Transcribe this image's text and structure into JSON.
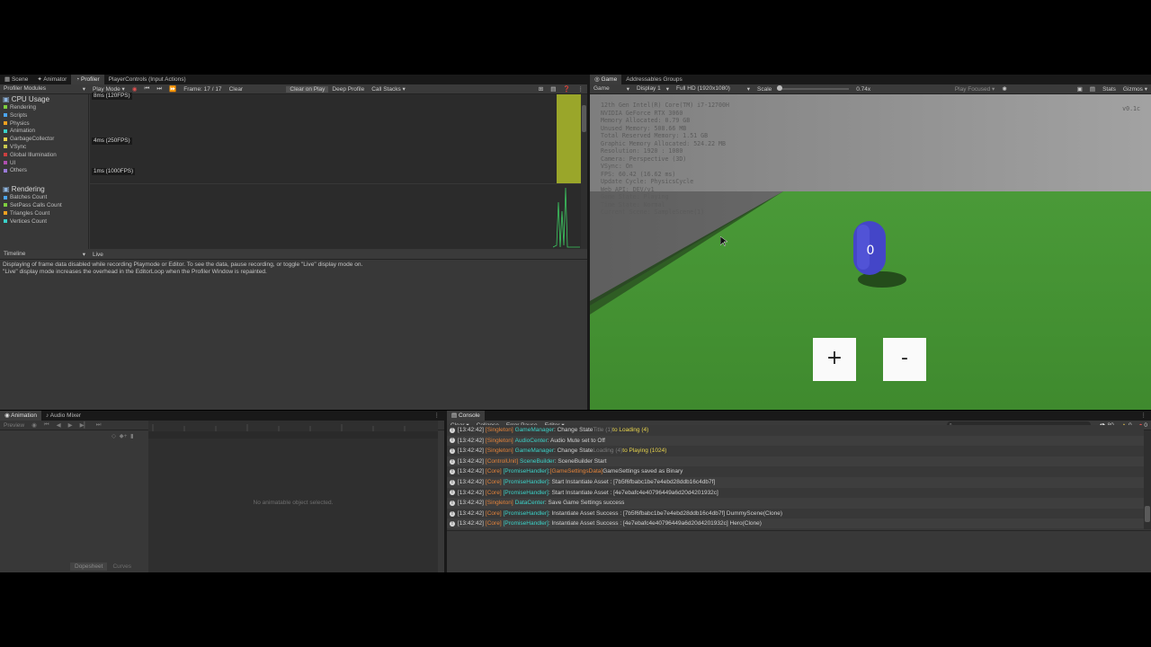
{
  "profiler": {
    "tabs": [
      "Scene",
      "Animator",
      "Profiler",
      "PlayerControls (Input Actions)"
    ],
    "toolbar": {
      "modules_dropdown": "Profiler Modules",
      "mode": "Play Mode",
      "frame": "Frame: 17 / 17",
      "clear": "Clear",
      "clear_on_play": "Clear on Play",
      "deep_profile": "Deep Profile",
      "call_stacks": "Call Stacks"
    },
    "cpu_module": {
      "title": "CPU Usage",
      "items": [
        {
          "label": "Rendering",
          "color": "#7dcf3f"
        },
        {
          "label": "Scripts",
          "color": "#4ba5f2"
        },
        {
          "label": "Physics",
          "color": "#f0a020"
        },
        {
          "label": "Animation",
          "color": "#3ad0c8"
        },
        {
          "label": "GarbageCollector",
          "color": "#e8d44d"
        },
        {
          "label": "VSync",
          "color": "#c8c850"
        },
        {
          "label": "Global Illumination",
          "color": "#cc3f3f"
        },
        {
          "label": "UI",
          "color": "#b04fb0"
        },
        {
          "label": "Others",
          "color": "#9a7ad8"
        }
      ],
      "chart_labels": [
        "8ms (120FPS)",
        "4ms (250FPS)",
        "1ms (1000FPS)"
      ]
    },
    "rendering_module": {
      "title": "Rendering",
      "items": [
        {
          "label": "Batches Count",
          "color": "#4ba5f2"
        },
        {
          "label": "SetPass Calls Count",
          "color": "#7dcf3f"
        },
        {
          "label": "Triangles Count",
          "color": "#f0a020"
        },
        {
          "label": "Vertices Count",
          "color": "#3ad0c8"
        }
      ]
    },
    "details": {
      "view": "Timeline",
      "live": "Live",
      "message_line1": "Displaying of frame data disabled while recording Playmode or Editor. To see the data, pause recording, or toggle \"Live\" display mode on.",
      "message_line2": "\"Live\" display mode increases the overhead in the EditorLoop when the Profiler Window is repainted."
    }
  },
  "game": {
    "tabs": [
      "Game",
      "Addressables Groups"
    ],
    "toolbar": {
      "mode": "Game",
      "display": "Display 1",
      "resolution": "Full HD (1920x1080)",
      "scale_label": "Scale",
      "scale_value": "0.74x",
      "play_focused": "Play Focused",
      "stats": "Stats",
      "gizmos": "Gizmos"
    },
    "hud_lines": [
      "12th Gen Intel(R) Core(TM) i7-12700H",
      "NVIDIA GeForce RTX 3060",
      "Memory Allocated: 0.79 GB",
      "Unused Memory: 508.66 MB",
      "Total Reserved Memory: 1.51 GB",
      "Graphic Memory Allocated: 524.22 MB",
      "Resolution: 1920 : 1080",
      "Camera: Perspective (3D)",
      "VSync: On",
      "FPS: 60.42 (16.62 ms)",
      "Update Cycle: PhysicsCycle",
      "Web API: DEV/v1",
      "Game State: Playing",
      "Time State: Normal",
      "Current Scene: SampleScene(1)"
    ],
    "version": "v0.1c",
    "counter": "0",
    "plus_label": "+",
    "minus_label": "-"
  },
  "animation": {
    "tabs": [
      "Animation",
      "Audio Mixer"
    ],
    "preview": "Preview",
    "empty_message": "No animatable object selected.",
    "bottom_tabs": [
      "Dopesheet",
      "Curves"
    ]
  },
  "console": {
    "tab": "Console",
    "toolbar": {
      "clear": "Clear",
      "collapse": "Collapse",
      "error_pause": "Error Pause",
      "editor": "Editor",
      "count_info": "80",
      "count_warn": "0",
      "count_error": "0"
    },
    "rows": [
      {
        "time": "[13:42:42]",
        "tag": "[Singleton]",
        "handler": "GameManager",
        "msg": " : Change State ",
        "extra": "Title (1)",
        "tail": " to Loading (4)"
      },
      {
        "time": "[13:42:42]",
        "tag": "[Singleton]",
        "handler": "AudioCenter",
        "msg": " : Audio Mute set to Off",
        "extra": "",
        "tail": ""
      },
      {
        "time": "[13:42:42]",
        "tag": "[Singleton]",
        "handler": "GameManager",
        "msg": " : Change State ",
        "extra": "Loading (4)",
        "tail": " to Playing (1024)"
      },
      {
        "time": "[13:42:42]",
        "tag": "[ControlUnit]",
        "handler": "SceneBuilder",
        "msg": " : SceneBuilder Start",
        "extra": "",
        "tail": ""
      },
      {
        "time": "[13:42:42]",
        "tag": "[Core]",
        "handler": "[PromiseHandler]",
        "msg": " : ",
        "extra": "[GameSettingsData]",
        "tail": " GameSettings saved as Binary"
      },
      {
        "time": "[13:42:42]",
        "tag": "[Core]",
        "handler": "[PromiseHandler]",
        "msg": " : Start Instantiate Asset : [7b5f6fbabc1be7e4ebd28ddb16c4db7f]",
        "extra": "",
        "tail": ""
      },
      {
        "time": "[13:42:42]",
        "tag": "[Core]",
        "handler": "[PromiseHandler]",
        "msg": " : Start Instantiate Asset : [4e7ebafc4e40796449a6d20d4201932c]",
        "extra": "",
        "tail": ""
      },
      {
        "time": "[13:42:42]",
        "tag": "[Singleton]",
        "handler": "DataCenter",
        "msg": " : Save Game Settings success",
        "extra": "",
        "tail": ""
      },
      {
        "time": "[13:42:42]",
        "tag": "[Core]",
        "handler": "[PromiseHandler]",
        "msg": " : Instantiate Asset Success : [7b5f6fbabc1be7e4ebd28ddb16c4db7f] DummyScene(Clone)",
        "extra": "",
        "tail": ""
      },
      {
        "time": "[13:42:42]",
        "tag": "[Core]",
        "handler": "[PromiseHandler]",
        "msg": " : Instantiate Asset Success : [4e7ebafc4e40796449a6d20d4201932c] Hero(Clone)",
        "extra": "",
        "tail": ""
      }
    ]
  }
}
